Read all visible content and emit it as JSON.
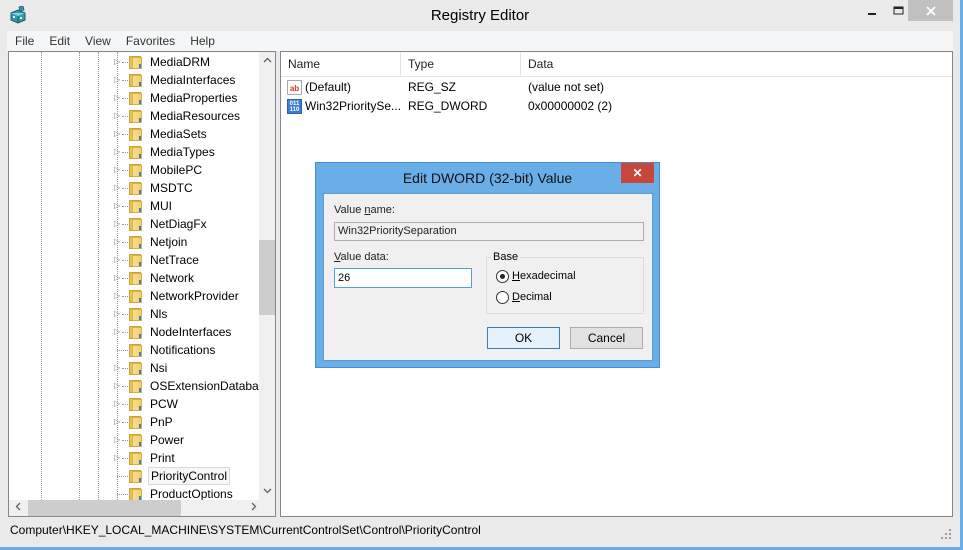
{
  "window": {
    "title": "Registry Editor",
    "icon": "registry-editor-icon",
    "controls": {
      "minimize": "minimize",
      "maximize": "maximize",
      "close": "close"
    }
  },
  "menu": [
    "File",
    "Edit",
    "View",
    "Favorites",
    "Help"
  ],
  "tree": {
    "items": [
      {
        "label": "MediaDRM",
        "expandable": true
      },
      {
        "label": "MediaInterfaces",
        "expandable": true
      },
      {
        "label": "MediaProperties",
        "expandable": true
      },
      {
        "label": "MediaResources",
        "expandable": true
      },
      {
        "label": "MediaSets",
        "expandable": true
      },
      {
        "label": "MediaTypes",
        "expandable": true
      },
      {
        "label": "MobilePC",
        "expandable": true
      },
      {
        "label": "MSDTC",
        "expandable": true
      },
      {
        "label": "MUI",
        "expandable": true
      },
      {
        "label": "NetDiagFx",
        "expandable": true
      },
      {
        "label": "Netjoin",
        "expandable": true
      },
      {
        "label": "NetTrace",
        "expandable": true
      },
      {
        "label": "Network",
        "expandable": true
      },
      {
        "label": "NetworkProvider",
        "expandable": true
      },
      {
        "label": "Nls",
        "expandable": true
      },
      {
        "label": "NodeInterfaces",
        "expandable": true
      },
      {
        "label": "Notifications",
        "expandable": false
      },
      {
        "label": "Nsi",
        "expandable": true
      },
      {
        "label": "OSExtensionDatabase",
        "expandable": true
      },
      {
        "label": "PCW",
        "expandable": true
      },
      {
        "label": "PnP",
        "expandable": true
      },
      {
        "label": "Power",
        "expandable": true
      },
      {
        "label": "Print",
        "expandable": true
      },
      {
        "label": "PriorityControl",
        "expandable": false,
        "selected": true
      },
      {
        "label": "ProductOptions",
        "expandable": false
      }
    ],
    "scroll_up": "^",
    "scroll_down": "v",
    "scroll_left": "<",
    "scroll_right": ">"
  },
  "list": {
    "columns": [
      "Name",
      "Type",
      "Data"
    ],
    "rows": [
      {
        "icon": "string-value-icon",
        "icon_text": "ab",
        "name": "(Default)",
        "type": "REG_SZ",
        "data": "(value not set)"
      },
      {
        "icon": "dword-value-icon",
        "icon_text": "011 110",
        "name": "Win32PrioritySe...",
        "type": "REG_DWORD",
        "data": "0x00000002 (2)"
      }
    ]
  },
  "statusbar": {
    "path": "Computer\\HKEY_LOCAL_MACHINE\\SYSTEM\\CurrentControlSet\\Control\\PriorityControl"
  },
  "dialog": {
    "title": "Edit DWORD (32-bit) Value",
    "close": "✕",
    "value_name_label_pre": "Value ",
    "value_name_label_u": "n",
    "value_name_label_post": "ame:",
    "value_name": "Win32PrioritySeparation",
    "value_data_label_u": "V",
    "value_data_label_post": "alue data:",
    "value_data": "26",
    "base_label": "Base",
    "base_options": [
      {
        "u": "H",
        "rest": "exadecimal",
        "checked": true
      },
      {
        "u": "D",
        "rest": "ecimal",
        "checked": false
      }
    ],
    "ok_label": "OK",
    "cancel_label": "Cancel"
  },
  "colors": {
    "accent_border": "#6aaee8",
    "close_red": "#c7483a",
    "default_button": "#3c7fb1"
  }
}
